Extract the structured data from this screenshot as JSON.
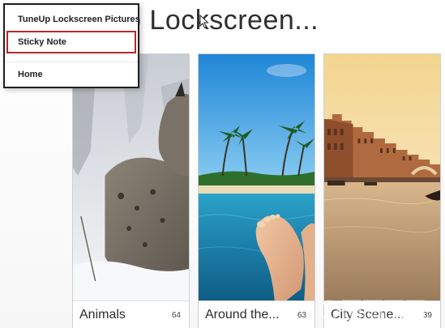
{
  "header": {
    "title": "Up Lockscreen..."
  },
  "menu": {
    "items": [
      {
        "label": "TuneUp Lockscreen Pictures"
      },
      {
        "label": "Sticky Note",
        "highlighted": true
      },
      {
        "label": "Home"
      }
    ]
  },
  "tiles": [
    {
      "name": "Animals",
      "count": "64",
      "image": "snow-lynx"
    },
    {
      "name": "Around the...",
      "count": "63",
      "image": "feet-in-tropical-sea"
    },
    {
      "name": "City Scene...",
      "count": "39",
      "image": "venice-canal-sunset"
    }
  ],
  "icons": {
    "cursor": "mouse-pointer-icon"
  },
  "colors": {
    "highlight_border": "#b42a2a",
    "menu_border": "#1f1f1f"
  }
}
